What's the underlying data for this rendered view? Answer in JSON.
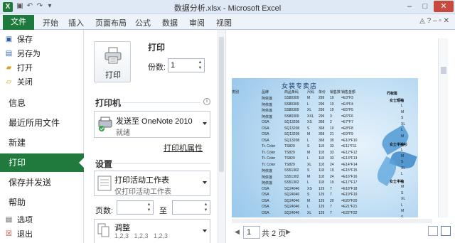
{
  "window": {
    "title": "数据分析.xlsx - Microsoft Excel",
    "min": "–",
    "max": "□",
    "close": "✕"
  },
  "ribbon": {
    "file_tab": "文件",
    "tabs": [
      "开始",
      "插入",
      "页面布局",
      "公式",
      "数据",
      "审阅",
      "视图"
    ]
  },
  "backstage": {
    "small_items": [
      {
        "label": "保存",
        "icon": "save-icon"
      },
      {
        "label": "另存为",
        "icon": "save-as-icon"
      },
      {
        "label": "打开",
        "icon": "open-folder-icon"
      },
      {
        "label": "关闭",
        "icon": "close-file-icon"
      }
    ],
    "big_items": [
      "信息",
      "最近所用文件",
      "新建",
      "打印",
      "保存并发送",
      "帮助"
    ],
    "selected": "打印",
    "bottom_items": [
      {
        "label": "选项",
        "icon": "options-icon"
      },
      {
        "label": "退出",
        "icon": "exit-icon"
      }
    ]
  },
  "print": {
    "header": "打印",
    "button_label": "打印",
    "copies_label": "份数:",
    "copies_value": "1",
    "printer_header": "打印机",
    "printer_name": "发送至 OneNote 2010",
    "printer_status": "就绪",
    "printer_properties": "打印机属性",
    "settings_header": "设置",
    "setting_scope_title": "打印活动工作表",
    "setting_scope_sub": "仅打印活动工作表",
    "pages_label": "页数:",
    "pages_to": "至",
    "collate_title": "调整",
    "collate_sub": "1,2,3   1,2,3   1,2,3"
  },
  "preview": {
    "shop_title": "女装专卖店",
    "headers": [
      "类别",
      "品牌",
      "商品条码",
      "尺码",
      "单价",
      "销售数",
      "销售金额"
    ],
    "rows": [
      [
        "",
        "阿依莲",
        "SS80309",
        "M",
        "299",
        "19",
        "=E3*F3"
      ],
      [
        "",
        "阿依莲",
        "SS80309",
        "L",
        "299",
        "19",
        "=E4*F4"
      ],
      [
        "",
        "阿依莲",
        "SS80309",
        "XL",
        "299",
        "19",
        "=E5*F5"
      ],
      [
        "",
        "阿依莲",
        "SS80309",
        "XXL",
        "299",
        "3",
        "=E6*F6"
      ],
      [
        "",
        "OSA",
        "SQ13208",
        "XS",
        "368",
        "2",
        "=E7*F7"
      ],
      [
        "",
        "OSA",
        "SQ13208",
        "S",
        "368",
        "10",
        "=E8*F8"
      ],
      [
        "",
        "OSA",
        "SQ13208",
        "M",
        "368",
        "21",
        "=E9*F9"
      ],
      [
        "",
        "OSA",
        "SQ13208",
        "L",
        "368",
        "30",
        "=E10*F10"
      ],
      [
        "",
        "Tt. Color",
        "TS829",
        "S",
        "118",
        "33",
        "=E11*F11"
      ],
      [
        "",
        "Tt. Color",
        "TS829",
        "M",
        "118",
        "33",
        "=E12*F12"
      ],
      [
        "",
        "Tt. Color",
        "TS829",
        "L",
        "118",
        "33",
        "=E13*F13"
      ],
      [
        "",
        "Tt. Color",
        "TS829",
        "XL",
        "118",
        "24",
        "=E14*F14"
      ],
      [
        "",
        "阿依莲",
        "SS51302",
        "S",
        "118",
        "19",
        "=E15*F15"
      ],
      [
        "",
        "阿依莲",
        "SS51302",
        "M",
        "118",
        "24",
        "=E16*F16"
      ],
      [
        "",
        "阿依莲",
        "SS51302",
        "L",
        "118",
        "19",
        "=E17*F17"
      ],
      [
        "",
        "OSA",
        "SQ24046",
        "XS",
        "129",
        "7",
        "=E18*F18"
      ],
      [
        "",
        "OSA",
        "SQ24046",
        "S",
        "129",
        "7",
        "=E19*F19"
      ],
      [
        "",
        "OSA",
        "SQ24046",
        "M",
        "129",
        "20",
        "=E20*F20"
      ],
      [
        "",
        "OSA",
        "SQ24046",
        "L",
        "129",
        "7",
        "=E21*F21"
      ],
      [
        "",
        "OSA",
        "SQ24046",
        "XL",
        "129",
        "7",
        "=E22*F22"
      ]
    ],
    "side_labels": [
      "行标签",
      "女士短袖",
      "女士半袖衫",
      "女士半袖"
    ],
    "side_col": [
      "L",
      "M",
      "S",
      "XL",
      "L",
      "M",
      "L",
      "M",
      "S",
      "XL",
      "L",
      "M",
      "S",
      "XL",
      "L",
      "M",
      "S",
      "XS"
    ],
    "page_current": "1",
    "page_total": "共 2 页"
  }
}
